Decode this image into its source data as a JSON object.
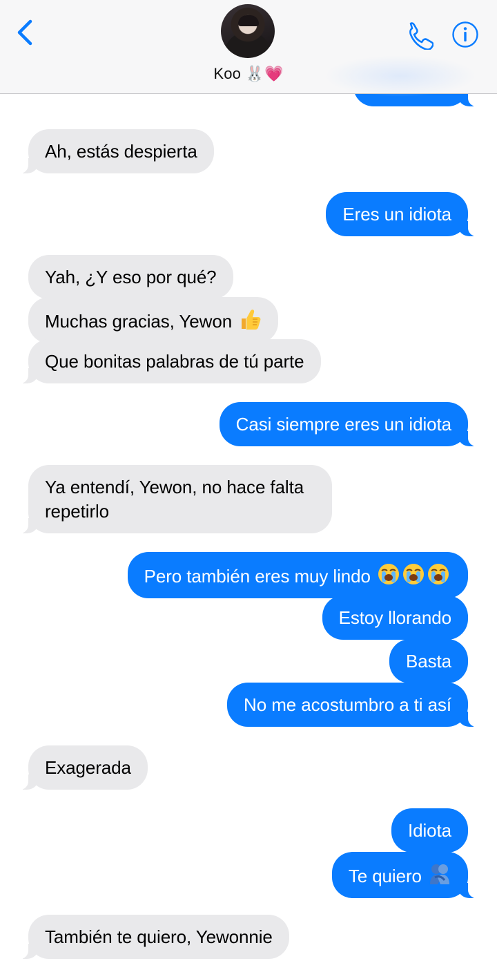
{
  "header": {
    "contact_name": "Koo 🐰💗"
  },
  "messages": [
    {
      "from": "out",
      "text": "",
      "partial": true
    },
    {
      "from": "in",
      "text": "Ah, estás despierta"
    },
    {
      "from": "out",
      "text": "Eres un idiota"
    },
    {
      "from": "in",
      "text": "Yah, ¿Y eso por qué?"
    },
    {
      "from": "in",
      "text": "Muchas gracias, Yewon",
      "emoji": "thumbs-up"
    },
    {
      "from": "in",
      "text": "Que bonitas palabras de tú parte"
    },
    {
      "from": "out",
      "text": "Casi siempre eres un idiota"
    },
    {
      "from": "in",
      "text": "Ya entendí, Yewon, no hace falta repetirlo"
    },
    {
      "from": "out",
      "text": "Pero también eres muy lindo",
      "emoji": "loudly-crying x3"
    },
    {
      "from": "out",
      "text": "Estoy llorando"
    },
    {
      "from": "out",
      "text": "Basta"
    },
    {
      "from": "out",
      "text": "No me acostumbro a ti así"
    },
    {
      "from": "in",
      "text": "Exagerada"
    },
    {
      "from": "out",
      "text": "Idiota"
    },
    {
      "from": "out",
      "text": "Te quiero",
      "emoji": "people-hugging"
    },
    {
      "from": "in",
      "text": "También te quiero, Yewonnie"
    }
  ],
  "colors": {
    "outgoing_bubble": "#0a7cff",
    "incoming_bubble": "#e9e9eb",
    "header_bg": "#f7f7f8",
    "accent": "#0a7cff"
  },
  "icons": [
    "chevron-left-icon",
    "phone-icon",
    "info-icon"
  ]
}
